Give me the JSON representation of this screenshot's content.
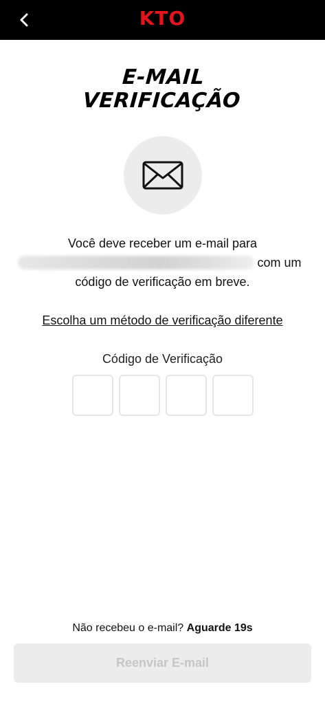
{
  "header": {
    "logo_text": "KTO",
    "logo_color": "#e3141d",
    "back_icon": "chevron-left-icon"
  },
  "title": {
    "line1": "E-MAIL",
    "line2": "VERIFICAÇÃO"
  },
  "icon": "envelope-icon",
  "message": {
    "line1": "Você deve receber um e-mail para",
    "line2_suffix": "com um",
    "line3": "código de verificação em breve."
  },
  "alt_method_link": "Escolha um método de verificação diferente",
  "code": {
    "label": "Código de Verificação",
    "digits": [
      "",
      "",
      "",
      ""
    ]
  },
  "resend": {
    "prompt": "Não recebeu o e-mail?",
    "countdown": "Aguarde 19s",
    "button_label": "Reenviar E-mail"
  }
}
